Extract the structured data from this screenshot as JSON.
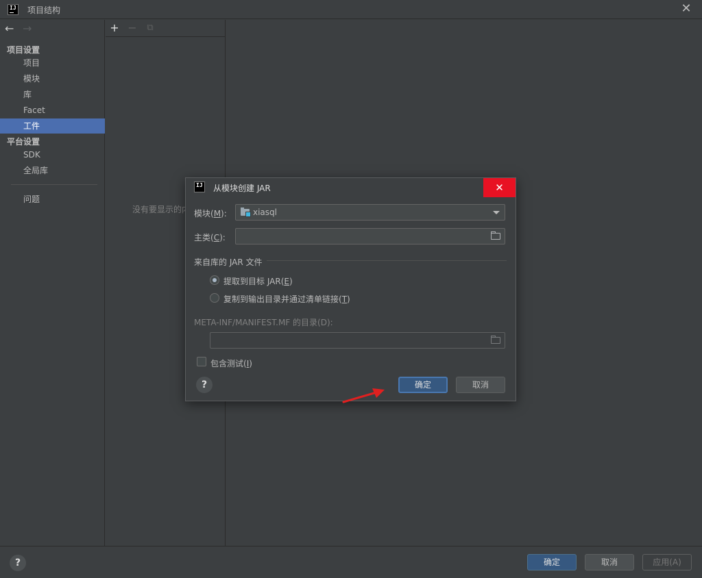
{
  "window": {
    "title": "项目结构"
  },
  "sidebar": {
    "section_project": "项目设置",
    "project_items": [
      "项目",
      "模块",
      "库",
      "Facet",
      "工件"
    ],
    "selected": "工件",
    "section_platform": "平台设置",
    "platform_items": [
      "SDK",
      "全局库"
    ],
    "problems": "问题"
  },
  "middle": {
    "empty_text": "没有要显示的内容"
  },
  "dialog": {
    "title": "从模块创建 JAR",
    "module_label_pre": "模块(",
    "module_label_key": "M",
    "module_label_post": "):",
    "module_value": "xiasql",
    "main_class_label_pre": "主类(",
    "main_class_label_key": "C",
    "main_class_label_post": "):",
    "main_class_value": "",
    "jar_group_label": "来自库的 JAR 文件",
    "radio_extract_pre": "提取到目标 JAR(",
    "radio_extract_key": "E",
    "radio_extract_post": ")",
    "radio_copy_pre": "复制到输出目录并通过清单链接(",
    "radio_copy_key": "T",
    "radio_copy_post": ")",
    "selected_radio": "extract",
    "manifest_label": "META-INF/MANIFEST.MF 的目录(D):",
    "manifest_value": "",
    "include_tests_pre": "包含测试(",
    "include_tests_key": "I",
    "include_tests_post": ")",
    "include_tests_checked": false,
    "ok_label": "确定",
    "cancel_label": "取消",
    "help_label": "?"
  },
  "footer": {
    "help_label": "?",
    "ok_label": "确定",
    "cancel_label": "取消",
    "apply_label": "应用(A)"
  },
  "colors": {
    "background": "#3c3f41",
    "selection": "#4b6eaf",
    "primary_button": "#365880",
    "dialog_close": "#e81123",
    "annotation_arrow": "#e02020"
  }
}
